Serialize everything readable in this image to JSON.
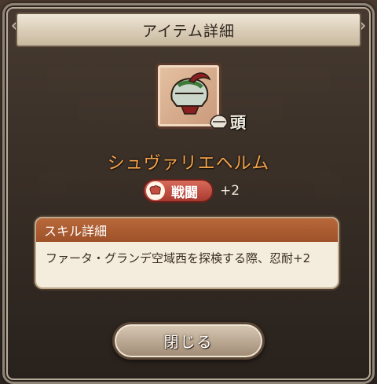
{
  "dialog": {
    "title": "アイテム詳細",
    "close_label": "閉じる"
  },
  "item": {
    "name": "シュヴァリエヘルム",
    "slot_label": "頭",
    "icon": "helmet-icon"
  },
  "skill": {
    "category_label": "戦闘",
    "category_icon": "fist-icon",
    "bonus": "+2"
  },
  "skill_detail": {
    "heading": "スキル詳細",
    "description": "ファータ・グランデ空域西を探検する際、忍耐+2"
  },
  "colors": {
    "item_name": "#f3a24a",
    "skill_pill": "#c44e40",
    "detail_header": "#b0602f",
    "frame_accent": "#8fd6e0"
  }
}
